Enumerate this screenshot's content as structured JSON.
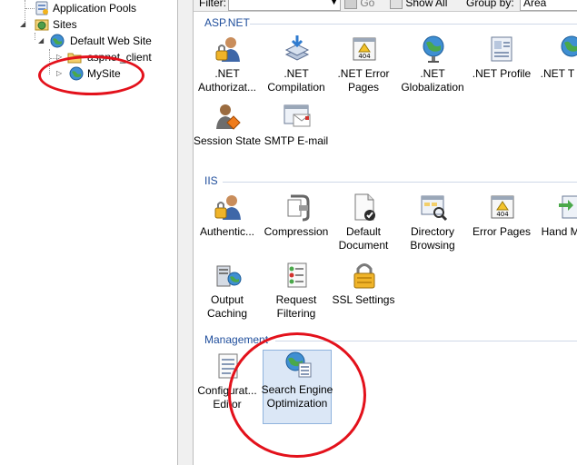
{
  "tree": {
    "items": [
      {
        "label": "Application Pools",
        "icon": "app-pools-icon"
      },
      {
        "label": "Sites",
        "icon": "sites-icon"
      },
      {
        "label": "Default Web Site",
        "icon": "globe-icon"
      },
      {
        "label": "aspnet_client",
        "icon": "folder-icon"
      },
      {
        "label": "MySite",
        "icon": "globe-icon"
      }
    ]
  },
  "toolbar": {
    "filter_label": "Filter:",
    "go_label": "Go",
    "show_all_label": "Show All",
    "group_by_label": "Group by:",
    "group_by_value": "Area"
  },
  "sections": {
    "aspnet": {
      "title": "ASP.NET",
      "features": [
        {
          "label": ".NET Authorizat...",
          "icon": "authorization-icon"
        },
        {
          "label": ".NET Compilation",
          "icon": "compilation-icon"
        },
        {
          "label": ".NET Error Pages",
          "icon": "error-page-404-icon"
        },
        {
          "label": ".NET Globalization",
          "icon": "globalization-icon"
        },
        {
          "label": ".NET Profile",
          "icon": "profile-icon"
        },
        {
          "label": ".NET T Leve",
          "icon": "trust-level-icon"
        },
        {
          "label": "Session State",
          "icon": "session-state-icon"
        },
        {
          "label": "SMTP E-mail",
          "icon": "smtp-email-icon"
        }
      ]
    },
    "iis": {
      "title": "IIS",
      "features": [
        {
          "label": "Authentic...",
          "icon": "authentication-icon"
        },
        {
          "label": "Compression",
          "icon": "compression-icon"
        },
        {
          "label": "Default Document",
          "icon": "default-document-icon"
        },
        {
          "label": "Directory Browsing",
          "icon": "directory-browsing-icon"
        },
        {
          "label": "Error Pages",
          "icon": "error-page-404-icon"
        },
        {
          "label": "Hand Mappi",
          "icon": "handler-mappings-icon"
        },
        {
          "label": "Output Caching",
          "icon": "output-caching-icon"
        },
        {
          "label": "Request Filtering",
          "icon": "request-filtering-icon"
        },
        {
          "label": "SSL Settings",
          "icon": "ssl-lock-icon"
        }
      ]
    },
    "management": {
      "title": "Management",
      "features": [
        {
          "label": "Configurat... Editor",
          "icon": "configuration-editor-icon"
        },
        {
          "label": "Search Engine Optimization",
          "icon": "seo-icon"
        }
      ]
    }
  },
  "colors": {
    "section_title": "#1f4e9c",
    "highlight_circle": "#e3111b",
    "selection_bg": "#dbe7f6"
  }
}
